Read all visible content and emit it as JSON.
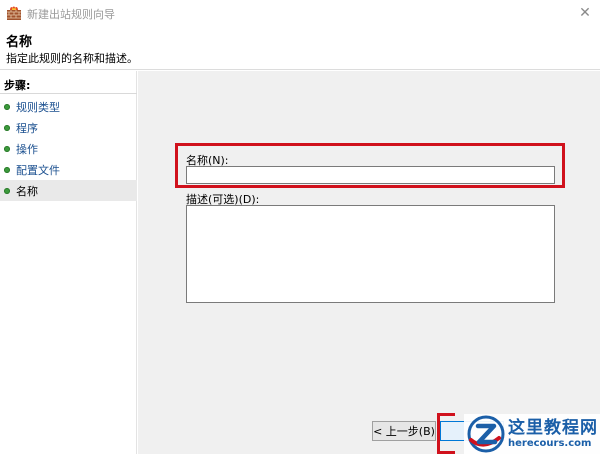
{
  "window": {
    "title": "新建出站规则向导",
    "close_glyph": "✕"
  },
  "header": {
    "title": "名称",
    "description": "指定此规则的名称和描述。"
  },
  "sidebar": {
    "steps_label": "步骤:",
    "items": [
      {
        "label": "规则类型",
        "current": false
      },
      {
        "label": "程序",
        "current": false
      },
      {
        "label": "操作",
        "current": false
      },
      {
        "label": "配置文件",
        "current": false
      },
      {
        "label": "名称",
        "current": true
      }
    ]
  },
  "form": {
    "name_label": "名称(N):",
    "name_value": "",
    "description_label": "描述(可选)(D):",
    "description_value": ""
  },
  "buttons": {
    "back_label": "< 上一步(B)"
  },
  "watermark": {
    "title": "这里教程网",
    "url": "herecours.com"
  },
  "colors": {
    "highlight": "#d0111c",
    "step_dot": "#3c9a3c",
    "step_link": "#1a4f8f",
    "panel_background": "#f0f0f0",
    "watermark_blue": "#1b5fa8"
  },
  "icons": {
    "app": "firewall-icon",
    "close": "close-icon",
    "step": "step-dot-icon",
    "watermark": "watermark-logo-icon"
  }
}
